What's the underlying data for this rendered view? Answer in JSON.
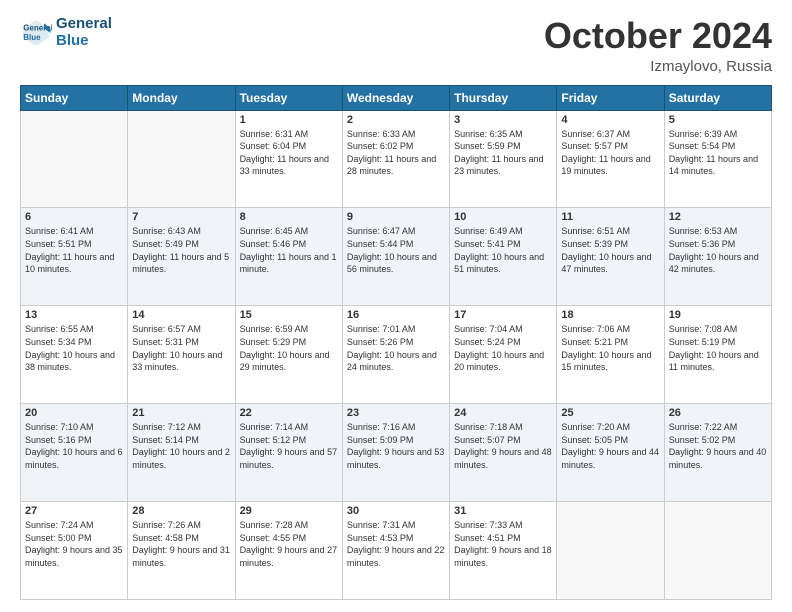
{
  "logo": {
    "line1": "General",
    "line2": "Blue"
  },
  "title": "October 2024",
  "subtitle": "Izmaylovo, Russia",
  "headers": [
    "Sunday",
    "Monday",
    "Tuesday",
    "Wednesday",
    "Thursday",
    "Friday",
    "Saturday"
  ],
  "weeks": [
    [
      {
        "day": "",
        "sunrise": "",
        "sunset": "",
        "daylight": ""
      },
      {
        "day": "",
        "sunrise": "",
        "sunset": "",
        "daylight": ""
      },
      {
        "day": "1",
        "sunrise": "Sunrise: 6:31 AM",
        "sunset": "Sunset: 6:04 PM",
        "daylight": "Daylight: 11 hours and 33 minutes."
      },
      {
        "day": "2",
        "sunrise": "Sunrise: 6:33 AM",
        "sunset": "Sunset: 6:02 PM",
        "daylight": "Daylight: 11 hours and 28 minutes."
      },
      {
        "day": "3",
        "sunrise": "Sunrise: 6:35 AM",
        "sunset": "Sunset: 5:59 PM",
        "daylight": "Daylight: 11 hours and 23 minutes."
      },
      {
        "day": "4",
        "sunrise": "Sunrise: 6:37 AM",
        "sunset": "Sunset: 5:57 PM",
        "daylight": "Daylight: 11 hours and 19 minutes."
      },
      {
        "day": "5",
        "sunrise": "Sunrise: 6:39 AM",
        "sunset": "Sunset: 5:54 PM",
        "daylight": "Daylight: 11 hours and 14 minutes."
      }
    ],
    [
      {
        "day": "6",
        "sunrise": "Sunrise: 6:41 AM",
        "sunset": "Sunset: 5:51 PM",
        "daylight": "Daylight: 11 hours and 10 minutes."
      },
      {
        "day": "7",
        "sunrise": "Sunrise: 6:43 AM",
        "sunset": "Sunset: 5:49 PM",
        "daylight": "Daylight: 11 hours and 5 minutes."
      },
      {
        "day": "8",
        "sunrise": "Sunrise: 6:45 AM",
        "sunset": "Sunset: 5:46 PM",
        "daylight": "Daylight: 11 hours and 1 minute."
      },
      {
        "day": "9",
        "sunrise": "Sunrise: 6:47 AM",
        "sunset": "Sunset: 5:44 PM",
        "daylight": "Daylight: 10 hours and 56 minutes."
      },
      {
        "day": "10",
        "sunrise": "Sunrise: 6:49 AM",
        "sunset": "Sunset: 5:41 PM",
        "daylight": "Daylight: 10 hours and 51 minutes."
      },
      {
        "day": "11",
        "sunrise": "Sunrise: 6:51 AM",
        "sunset": "Sunset: 5:39 PM",
        "daylight": "Daylight: 10 hours and 47 minutes."
      },
      {
        "day": "12",
        "sunrise": "Sunrise: 6:53 AM",
        "sunset": "Sunset: 5:36 PM",
        "daylight": "Daylight: 10 hours and 42 minutes."
      }
    ],
    [
      {
        "day": "13",
        "sunrise": "Sunrise: 6:55 AM",
        "sunset": "Sunset: 5:34 PM",
        "daylight": "Daylight: 10 hours and 38 minutes."
      },
      {
        "day": "14",
        "sunrise": "Sunrise: 6:57 AM",
        "sunset": "Sunset: 5:31 PM",
        "daylight": "Daylight: 10 hours and 33 minutes."
      },
      {
        "day": "15",
        "sunrise": "Sunrise: 6:59 AM",
        "sunset": "Sunset: 5:29 PM",
        "daylight": "Daylight: 10 hours and 29 minutes."
      },
      {
        "day": "16",
        "sunrise": "Sunrise: 7:01 AM",
        "sunset": "Sunset: 5:26 PM",
        "daylight": "Daylight: 10 hours and 24 minutes."
      },
      {
        "day": "17",
        "sunrise": "Sunrise: 7:04 AM",
        "sunset": "Sunset: 5:24 PM",
        "daylight": "Daylight: 10 hours and 20 minutes."
      },
      {
        "day": "18",
        "sunrise": "Sunrise: 7:06 AM",
        "sunset": "Sunset: 5:21 PM",
        "daylight": "Daylight: 10 hours and 15 minutes."
      },
      {
        "day": "19",
        "sunrise": "Sunrise: 7:08 AM",
        "sunset": "Sunset: 5:19 PM",
        "daylight": "Daylight: 10 hours and 11 minutes."
      }
    ],
    [
      {
        "day": "20",
        "sunrise": "Sunrise: 7:10 AM",
        "sunset": "Sunset: 5:16 PM",
        "daylight": "Daylight: 10 hours and 6 minutes."
      },
      {
        "day": "21",
        "sunrise": "Sunrise: 7:12 AM",
        "sunset": "Sunset: 5:14 PM",
        "daylight": "Daylight: 10 hours and 2 minutes."
      },
      {
        "day": "22",
        "sunrise": "Sunrise: 7:14 AM",
        "sunset": "Sunset: 5:12 PM",
        "daylight": "Daylight: 9 hours and 57 minutes."
      },
      {
        "day": "23",
        "sunrise": "Sunrise: 7:16 AM",
        "sunset": "Sunset: 5:09 PM",
        "daylight": "Daylight: 9 hours and 53 minutes."
      },
      {
        "day": "24",
        "sunrise": "Sunrise: 7:18 AM",
        "sunset": "Sunset: 5:07 PM",
        "daylight": "Daylight: 9 hours and 48 minutes."
      },
      {
        "day": "25",
        "sunrise": "Sunrise: 7:20 AM",
        "sunset": "Sunset: 5:05 PM",
        "daylight": "Daylight: 9 hours and 44 minutes."
      },
      {
        "day": "26",
        "sunrise": "Sunrise: 7:22 AM",
        "sunset": "Sunset: 5:02 PM",
        "daylight": "Daylight: 9 hours and 40 minutes."
      }
    ],
    [
      {
        "day": "27",
        "sunrise": "Sunrise: 7:24 AM",
        "sunset": "Sunset: 5:00 PM",
        "daylight": "Daylight: 9 hours and 35 minutes."
      },
      {
        "day": "28",
        "sunrise": "Sunrise: 7:26 AM",
        "sunset": "Sunset: 4:58 PM",
        "daylight": "Daylight: 9 hours and 31 minutes."
      },
      {
        "day": "29",
        "sunrise": "Sunrise: 7:28 AM",
        "sunset": "Sunset: 4:55 PM",
        "daylight": "Daylight: 9 hours and 27 minutes."
      },
      {
        "day": "30",
        "sunrise": "Sunrise: 7:31 AM",
        "sunset": "Sunset: 4:53 PM",
        "daylight": "Daylight: 9 hours and 22 minutes."
      },
      {
        "day": "31",
        "sunrise": "Sunrise: 7:33 AM",
        "sunset": "Sunset: 4:51 PM",
        "daylight": "Daylight: 9 hours and 18 minutes."
      },
      {
        "day": "",
        "sunrise": "",
        "sunset": "",
        "daylight": ""
      },
      {
        "day": "",
        "sunrise": "",
        "sunset": "",
        "daylight": ""
      }
    ]
  ]
}
